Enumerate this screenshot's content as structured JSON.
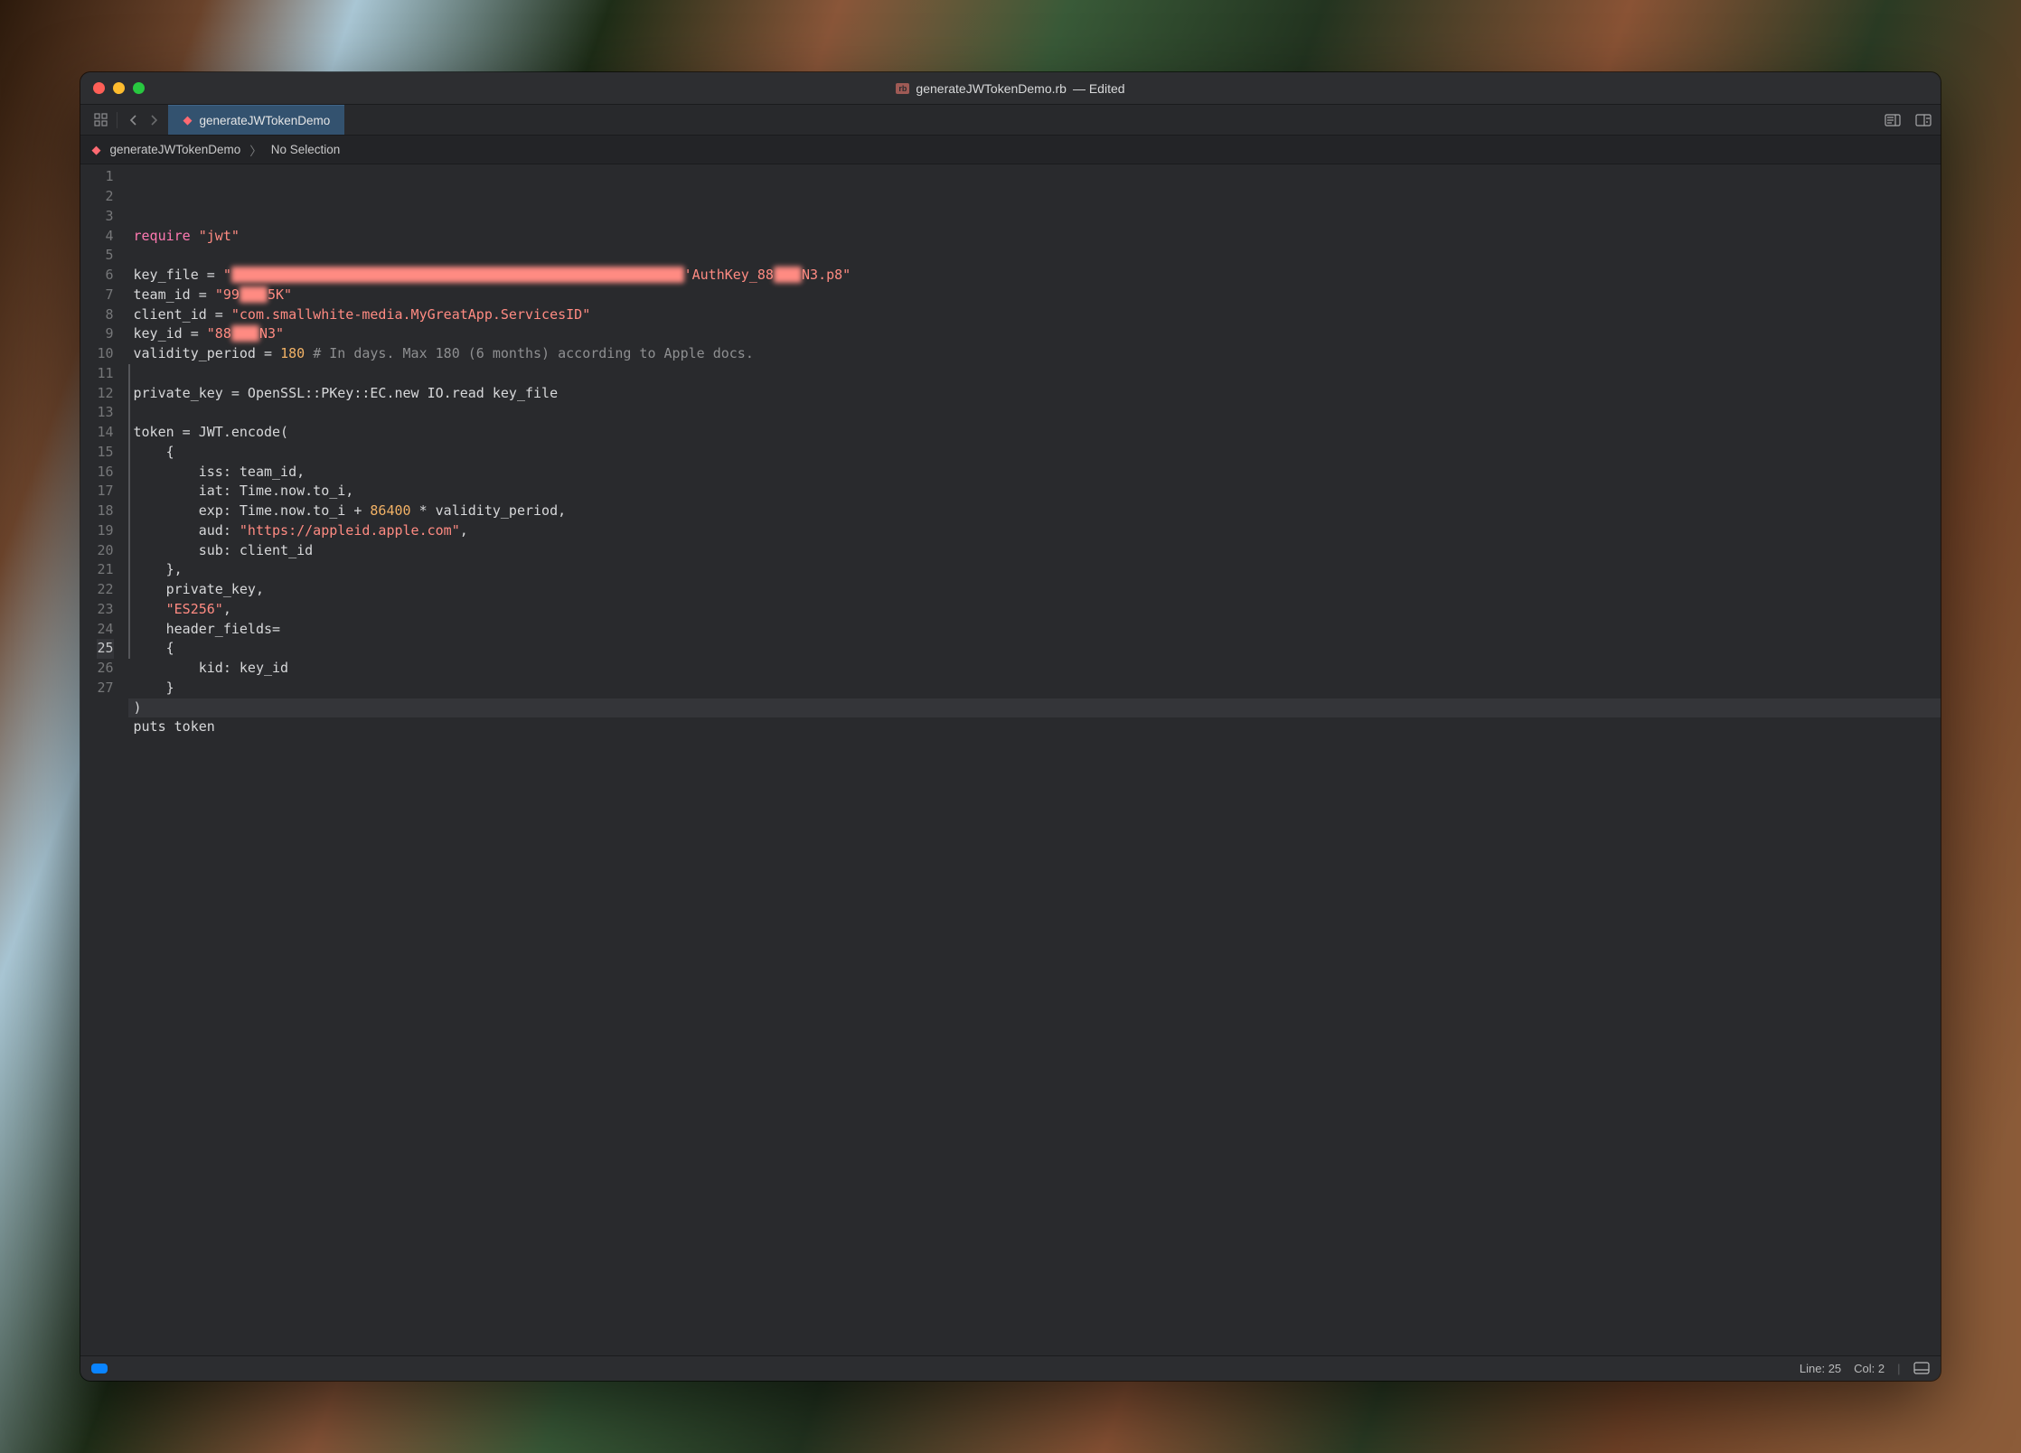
{
  "title": {
    "doc_icon": "rb",
    "filename": "generateJWTokenDemo.rb",
    "suffix": "— Edited"
  },
  "tab": {
    "label": "generateJWTokenDemo"
  },
  "breadcrumb": {
    "file": "generateJWTokenDemo",
    "selection": "No Selection"
  },
  "status": {
    "line_label": "Line:",
    "line_value": "25",
    "col_label": "Col:",
    "col_value": "2"
  },
  "code": {
    "lines": [
      {
        "n": 1,
        "segs": [
          [
            "kw",
            "require"
          ],
          [
            "",
            " "
          ],
          [
            "str",
            "\"jwt\""
          ]
        ]
      },
      {
        "n": 2,
        "segs": []
      },
      {
        "n": 3,
        "segs": [
          [
            "",
            "key_file = "
          ],
          [
            "str",
            "\""
          ],
          [
            "blur",
            "████████████████.█████████, ████████████'█████████.████"
          ],
          [
            "str",
            "'AuthKey_88"
          ],
          [
            "blur",
            "███"
          ],
          [
            "str",
            "N3.p8\""
          ]
        ]
      },
      {
        "n": 4,
        "segs": [
          [
            "",
            "team_id = "
          ],
          [
            "str",
            "\"99"
          ],
          [
            "blur",
            "███"
          ],
          [
            "str",
            "5K\""
          ]
        ]
      },
      {
        "n": 5,
        "segs": [
          [
            "",
            "client_id = "
          ],
          [
            "str",
            "\"com.smallwhite-media.MyGreatApp.ServicesID\""
          ]
        ]
      },
      {
        "n": 6,
        "segs": [
          [
            "",
            "key_id = "
          ],
          [
            "str",
            "\"88"
          ],
          [
            "blur",
            "███"
          ],
          [
            "str",
            "N3\""
          ]
        ]
      },
      {
        "n": 7,
        "segs": [
          [
            "",
            "validity_period = "
          ],
          [
            "num",
            "180"
          ],
          [
            "",
            " "
          ],
          [
            "cmt",
            "# In days. Max 180 (6 months) according to Apple docs."
          ]
        ]
      },
      {
        "n": 8,
        "segs": []
      },
      {
        "n": 9,
        "segs": [
          [
            "",
            "private_key = OpenSSL::PKey::EC.new IO.read key_file"
          ]
        ]
      },
      {
        "n": 10,
        "segs": []
      },
      {
        "n": 11,
        "segs": [
          [
            "",
            "token = JWT.encode("
          ]
        ]
      },
      {
        "n": 12,
        "segs": [
          [
            "",
            "    {"
          ]
        ]
      },
      {
        "n": 13,
        "segs": [
          [
            "",
            "        iss: team_id,"
          ]
        ]
      },
      {
        "n": 14,
        "segs": [
          [
            "",
            "        iat: Time.now.to_i,"
          ]
        ]
      },
      {
        "n": 15,
        "segs": [
          [
            "",
            "        exp: Time.now.to_i + "
          ],
          [
            "num",
            "86400"
          ],
          [
            "",
            " * validity_period,"
          ]
        ]
      },
      {
        "n": 16,
        "segs": [
          [
            "",
            "        aud: "
          ],
          [
            "str",
            "\"https://appleid.apple.com\""
          ],
          [
            "",
            ","
          ]
        ]
      },
      {
        "n": 17,
        "segs": [
          [
            "",
            "        sub: client_id"
          ]
        ]
      },
      {
        "n": 18,
        "segs": [
          [
            "",
            "    },"
          ]
        ]
      },
      {
        "n": 19,
        "segs": [
          [
            "",
            "    private_key,"
          ]
        ]
      },
      {
        "n": 20,
        "segs": [
          [
            "",
            "    "
          ],
          [
            "str",
            "\"ES256\""
          ],
          [
            "",
            ","
          ]
        ]
      },
      {
        "n": 21,
        "segs": [
          [
            "",
            "    header_fields="
          ]
        ]
      },
      {
        "n": 22,
        "segs": [
          [
            "",
            "    {"
          ]
        ]
      },
      {
        "n": 23,
        "segs": [
          [
            "",
            "        kid: key_id"
          ]
        ]
      },
      {
        "n": 24,
        "segs": [
          [
            "",
            "    }"
          ]
        ]
      },
      {
        "n": 25,
        "segs": [
          [
            "",
            ")"
          ]
        ],
        "current": true
      },
      {
        "n": 26,
        "segs": [
          [
            "",
            "puts token"
          ]
        ]
      },
      {
        "n": 27,
        "segs": []
      }
    ]
  }
}
